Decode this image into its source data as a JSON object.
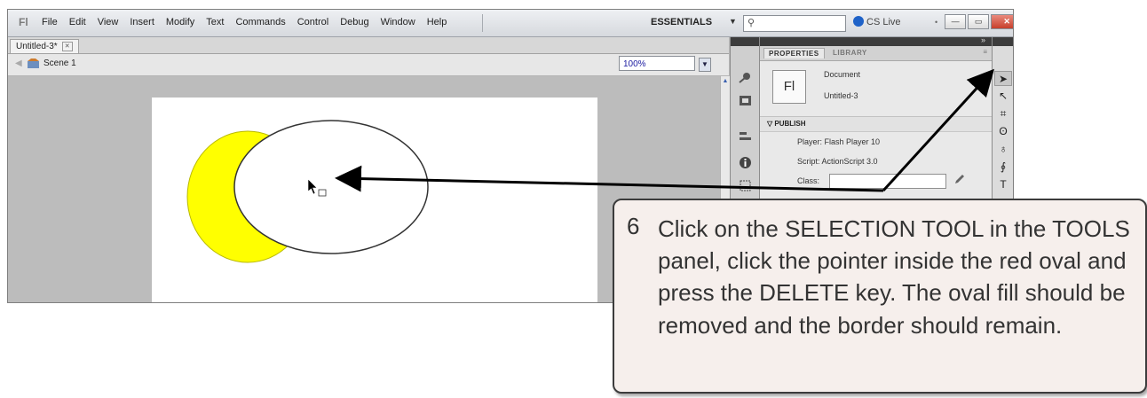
{
  "menubar": {
    "logo": "Fl",
    "items": [
      "File",
      "Edit",
      "View",
      "Insert",
      "Modify",
      "Text",
      "Commands",
      "Control",
      "Debug",
      "Window",
      "Help"
    ],
    "workspace": "ESSENTIALS",
    "cslive": "CS Live"
  },
  "document": {
    "tab": "Untitled-3*",
    "scene": "Scene 1",
    "zoom": "100%"
  },
  "properties": {
    "tabs": [
      "PROPERTIES",
      "LIBRARY"
    ],
    "doc_icon": "Fl",
    "doc_type": "Document",
    "doc_name": "Untitled-3",
    "section": "PUBLISH",
    "player": "Player: Flash Player 10",
    "script": "Script: ActionScript 3.0",
    "class_label": "Class:",
    "class_value": ""
  },
  "tools": [
    "selection-tool",
    "subselection-tool",
    "free-transform-tool",
    "lasso-tool",
    "pen-tool",
    "text-tool"
  ],
  "callout": {
    "number": "6",
    "text": "Click on the SELECTION TOOL in the TOOLS panel, click the pointer inside the red oval and press the DELETE key.  The oval fill should be removed and the border should remain."
  },
  "colors": {
    "crescent_fill": "#ffff00",
    "oval_fill": "#ffffff",
    "callout_bg": "#f6efec",
    "arrow": "#000000"
  }
}
